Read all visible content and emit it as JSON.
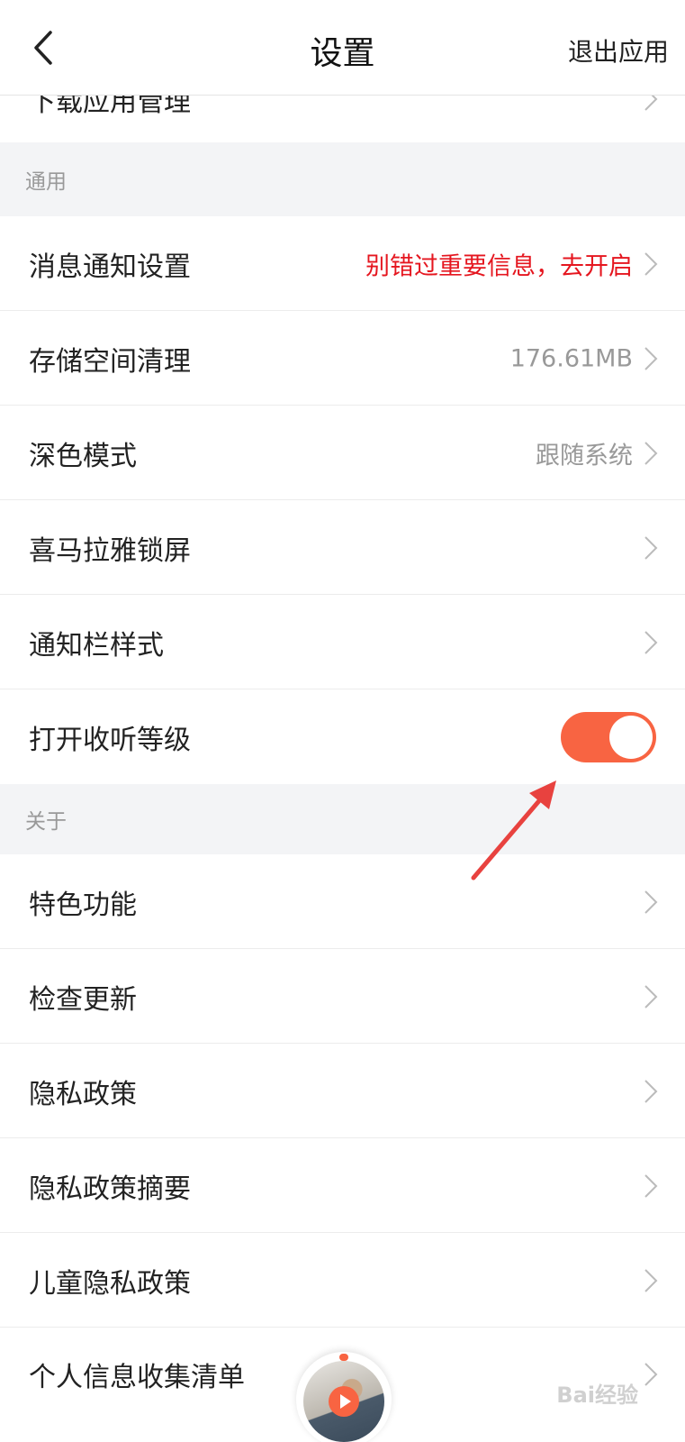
{
  "header": {
    "title": "设置",
    "exit_label": "退出应用",
    "back_icon": "chevron-left-icon"
  },
  "partial_row": {
    "label": "下载应用管理"
  },
  "sections": [
    {
      "title": "通用"
    },
    {
      "title": "关于"
    }
  ],
  "general_items": [
    {
      "label": "消息通知设置",
      "value": "别错过重要信息，去开启",
      "value_color": "#e5161f"
    },
    {
      "label": "存储空间清理",
      "value": "176.61MB"
    },
    {
      "label": "深色模式",
      "value": "跟随系统"
    },
    {
      "label": "喜马拉雅锁屏",
      "value": ""
    },
    {
      "label": "通知栏样式",
      "value": ""
    },
    {
      "label": "打开收听等级",
      "toggle": true,
      "toggle_on": true,
      "toggle_color": "#f86442"
    }
  ],
  "about_items": [
    {
      "label": "特色功能"
    },
    {
      "label": "检查更新"
    },
    {
      "label": "隐私政策"
    },
    {
      "label": "隐私政策摘要"
    },
    {
      "label": "儿童隐私政策"
    },
    {
      "label": "个人信息收集清单"
    }
  ],
  "annotation": {
    "arrow_color": "#e8423f"
  },
  "watermark": {
    "text": "Bai经验"
  }
}
